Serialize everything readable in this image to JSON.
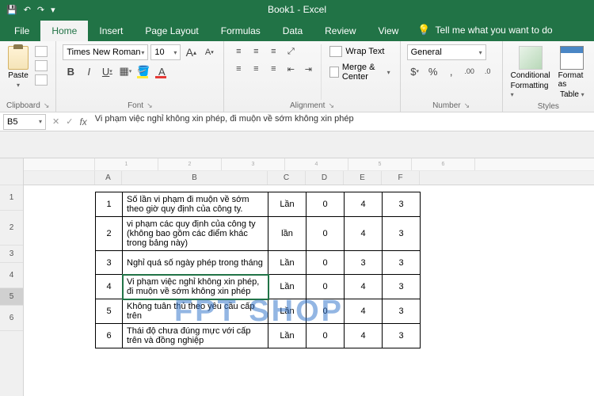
{
  "titlebar": {
    "title": "Book1 - Excel"
  },
  "tabs": {
    "file": "File",
    "home": "Home",
    "insert": "Insert",
    "pageLayout": "Page Layout",
    "formulas": "Formulas",
    "data": "Data",
    "review": "Review",
    "view": "View",
    "tellme": "Tell me what you want to do"
  },
  "ribbon": {
    "clipboard": {
      "label": "Clipboard",
      "paste": "Paste"
    },
    "font": {
      "label": "Font",
      "name": "Times New Roman",
      "size": "10",
      "increase": "A",
      "decrease": "A",
      "bold": "B",
      "italic": "I",
      "underline": "U"
    },
    "alignment": {
      "label": "Alignment",
      "wrap": "Wrap Text",
      "merge": "Merge & Center"
    },
    "number": {
      "label": "Number",
      "format": "General"
    },
    "styles": {
      "label": "Styles",
      "conditional": "Conditional",
      "conditional2": "Formatting",
      "table": "Format as",
      "table2": "Table"
    }
  },
  "formulaBar": {
    "cellRef": "B5",
    "formula": "Vi phạm việc nghỉ không xin phép, đi muộn về sớm không xin phép"
  },
  "columns": {
    "a": "A",
    "b": "B",
    "c": "C",
    "d": "D",
    "e": "E",
    "f": "F"
  },
  "rowLabels": [
    "1",
    "2",
    "3",
    "4",
    "5",
    "6"
  ],
  "rulerMarks": [
    "1",
    "2",
    "3",
    "4",
    "5",
    "6"
  ],
  "tableRows": [
    {
      "n": "1",
      "desc": "Số lần vi phạm đi muộn về sớm theo giờ quy định của công ty.",
      "unit": "Lần",
      "v1": "0",
      "v2": "4",
      "v3": "3"
    },
    {
      "n": "2",
      "desc": "vi phạm các quy định của công ty (không bao gồm các điểm khác trong bảng này)",
      "unit": "lần",
      "v1": "0",
      "v2": "4",
      "v3": "3"
    },
    {
      "n": "3",
      "desc": "Nghỉ quá số ngày phép trong tháng",
      "unit": "Lần",
      "v1": "0",
      "v2": "3",
      "v3": "3"
    },
    {
      "n": "4",
      "desc": "Vi phạm việc nghỉ không xin phép, đi muộn về sớm không xin phép",
      "unit": "Lần",
      "v1": "0",
      "v2": "4",
      "v3": "3"
    },
    {
      "n": "5",
      "desc": "Không tuân thủ theo yêu cầu cấp trên",
      "unit": "Lần",
      "v1": "0",
      "v2": "4",
      "v3": "3"
    },
    {
      "n": "6",
      "desc": "Thái độ chưa đúng mực với cấp trên và đồng nghiệp",
      "unit": "Lần",
      "v1": "0",
      "v2": "4",
      "v3": "3"
    }
  ],
  "watermark": "FPT SHOP"
}
